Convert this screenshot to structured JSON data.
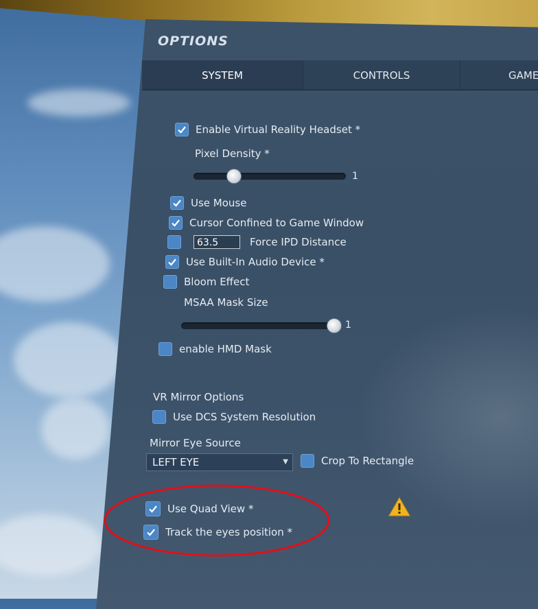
{
  "window": {
    "title": "OPTIONS"
  },
  "tabs": [
    {
      "label": "SYSTEM",
      "active": true
    },
    {
      "label": "CONTROLS",
      "active": false
    },
    {
      "label": "GAME",
      "active": false
    }
  ],
  "vr_options": {
    "enable_vr_headset": {
      "label": "Enable Virtual Reality Headset *",
      "checked": true
    },
    "pixel_density": {
      "label": "Pixel Density *",
      "value": "1"
    },
    "use_mouse": {
      "label": "Use Mouse",
      "checked": true
    },
    "cursor_confined": {
      "label": "Cursor Confined to Game Window",
      "checked": true
    },
    "force_ipd": {
      "label": "Force IPD Distance",
      "checked": false,
      "value": "63.5"
    },
    "builtin_audio": {
      "label": "Use Built-In Audio Device *",
      "checked": true
    },
    "bloom": {
      "label": "Bloom Effect",
      "checked": false
    },
    "msaa_mask_size": {
      "label": "MSAA Mask Size",
      "value": "1"
    },
    "hmd_mask": {
      "label": "enable HMD Mask",
      "checked": false
    }
  },
  "mirror": {
    "heading": "VR Mirror Options",
    "use_dcs_resolution": {
      "label": "Use DCS System Resolution",
      "checked": false
    },
    "eye_source_label": "Mirror Eye Source",
    "eye_source_value": "LEFT EYE",
    "crop_to_rectangle": {
      "label": "Crop To Rectangle",
      "checked": false
    }
  },
  "quad_view": {
    "use_quad_view": {
      "label": "Use Quad View *",
      "checked": true
    },
    "track_eyes": {
      "label": "Track the eyes position *",
      "checked": true
    },
    "warning_icon": "warning-triangle-icon"
  },
  "colors": {
    "panel": "#3a5066",
    "checkbox": "#4b86c6",
    "annotation": "#e0101a",
    "warning": "#f2b41c"
  }
}
